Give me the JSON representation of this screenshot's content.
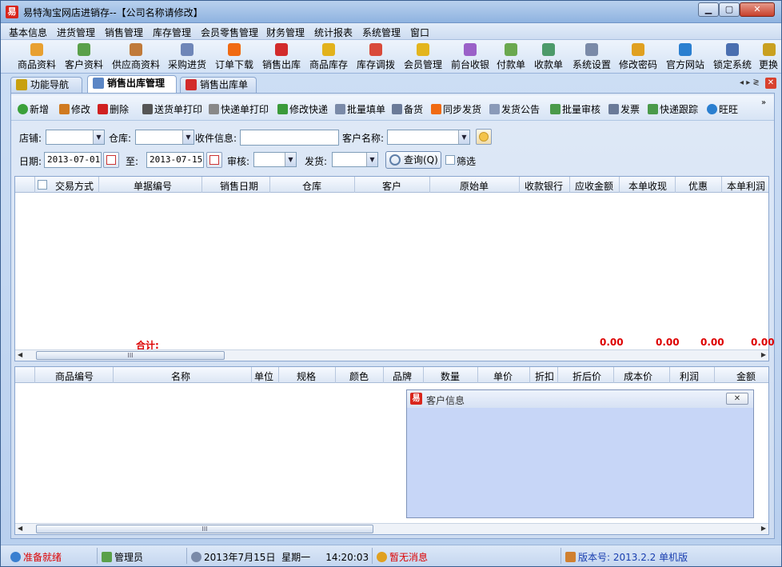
{
  "window": {
    "title": "易特淘宝网店进销存--【公司名称请修改】",
    "app_icon": "易",
    "min": "▁",
    "max": "▢",
    "close": "✕"
  },
  "menu": [
    "基本信息",
    "进货管理",
    "销售管理",
    "库存管理",
    "会员零售管理",
    "财务管理",
    "统计报表",
    "系统管理",
    "窗口"
  ],
  "toolbar": [
    {
      "label": "商品资料",
      "icon": "box-icon",
      "color": "#e8a030"
    },
    {
      "label": "客户资料",
      "icon": "people-icon",
      "color": "#5aa04a"
    },
    {
      "label": "供应商资料",
      "icon": "supplier-icon",
      "color": "#c07a3a"
    },
    {
      "label": "采购进货",
      "icon": "truck-icon",
      "color": "#6f86b8"
    },
    {
      "label": "订单下载",
      "icon": "taobao-icon",
      "color": "#f06a12"
    },
    {
      "label": "销售出库",
      "icon": "basket-icon",
      "color": "#d22b2b"
    },
    {
      "label": "商品库存",
      "icon": "stock-icon",
      "color": "#e2b21c"
    },
    {
      "label": "库存调拨",
      "icon": "transfer-icon",
      "color": "#d94a3a"
    },
    {
      "label": "会员管理",
      "icon": "member-icon",
      "color": "#e3b51e"
    },
    {
      "label": "前台收银",
      "icon": "cashier-icon",
      "color": "#9a60c8"
    },
    {
      "label": "付款单",
      "icon": "pay-icon",
      "color": "#6aa84f"
    },
    {
      "label": "收款单",
      "icon": "receive-icon",
      "color": "#4c9a6a"
    },
    {
      "label": "系统设置",
      "icon": "settings-icon",
      "color": "#7a8aa8"
    },
    {
      "label": "修改密码",
      "icon": "key-icon",
      "color": "#e0a020"
    },
    {
      "label": "官方网站",
      "icon": "ie-icon",
      "color": "#2a7fd0"
    },
    {
      "label": "锁定系统",
      "icon": "lock-icon",
      "color": "#4a6fb0"
    },
    {
      "label": "更换",
      "icon": "switch-icon",
      "color": "#c9a020"
    }
  ],
  "tabs": [
    {
      "label": "功能导航",
      "icon": "nav-icon",
      "color": "#c8a010"
    },
    {
      "label": "销售出库管理",
      "icon": "doc-icon",
      "color": "#5b86c5"
    },
    {
      "label": "销售出库单",
      "icon": "basket-icon",
      "color": "#d22b2b"
    }
  ],
  "tab_controls": {
    "left": "◂",
    "right": "▸",
    "menu": "≷",
    "close": "✕"
  },
  "actions": [
    {
      "label": "新增",
      "icon": "add-icon",
      "color": "#3aa03a"
    },
    {
      "label": "修改",
      "icon": "edit-icon",
      "color": "#d07a20"
    },
    {
      "label": "删除",
      "icon": "delete-icon",
      "color": "#d02020"
    },
    {
      "label": "送货单打印",
      "icon": "print-icon",
      "color": "#555"
    },
    {
      "label": "快递单打印",
      "icon": "print-express-icon",
      "color": "#888"
    },
    {
      "label": "修改快递",
      "icon": "express-edit-icon",
      "color": "#3a9a3a"
    },
    {
      "label": "批量填单",
      "icon": "list-icon",
      "color": "#7a8aa8"
    },
    {
      "label": "备货",
      "icon": "prepare-icon",
      "color": "#6a7a98"
    },
    {
      "label": "同步发货",
      "icon": "taobao-icon",
      "color": "#f06a12"
    },
    {
      "label": "发货公告",
      "icon": "speaker-icon",
      "color": "#8a9ab8"
    },
    {
      "label": "批量审核",
      "icon": "audit-icon",
      "color": "#4a9a4a"
    },
    {
      "label": "发票",
      "icon": "invoice-icon",
      "color": "#6a7a98"
    },
    {
      "label": "快递跟踪",
      "icon": "track-icon",
      "color": "#4a9a4a"
    },
    {
      "label": "旺旺",
      "icon": "wangwang-icon",
      "color": "#2a7fd0"
    }
  ],
  "filters": {
    "shop_label": "店铺:",
    "warehouse_label": "仓库:",
    "receiver_label": "收件信息:",
    "customer_label": "客户名称:",
    "date_label": "日期:",
    "date_from": "2013-07-01",
    "to_label": "至:",
    "date_to": "2013-07-15",
    "audit_label": "审核:",
    "ship_label": "发货:",
    "query_label": "查询(Q)",
    "filter_label": "筛选"
  },
  "grid1": {
    "columns": [
      "交易方式",
      "单据编号",
      "销售日期",
      "仓库",
      "客户",
      "原始单",
      "收款银行",
      "应收金额",
      "本单收现",
      "优惠",
      "本单利润"
    ],
    "total_label": "合计:",
    "totals": [
      "0.00",
      "0.00",
      "0.00",
      "0.00"
    ],
    "scroll_mark": "III"
  },
  "grid2": {
    "columns": [
      "商品编号",
      "名称",
      "单位",
      "规格",
      "颜色",
      "品牌",
      "数量",
      "单价",
      "折扣",
      "折后价",
      "成本价",
      "利润",
      "金额"
    ],
    "scroll_mark": "III"
  },
  "customer_panel": {
    "title": "客户信息",
    "icon": "易",
    "close": "✕"
  },
  "status": {
    "ready": "准备就绪",
    "user": "管理员",
    "date": "2013年7月15日",
    "weekday": "星期一",
    "time": "14:20:03",
    "message": "暂无消息",
    "version": "版本号: 2013.2.2 单机版"
  }
}
